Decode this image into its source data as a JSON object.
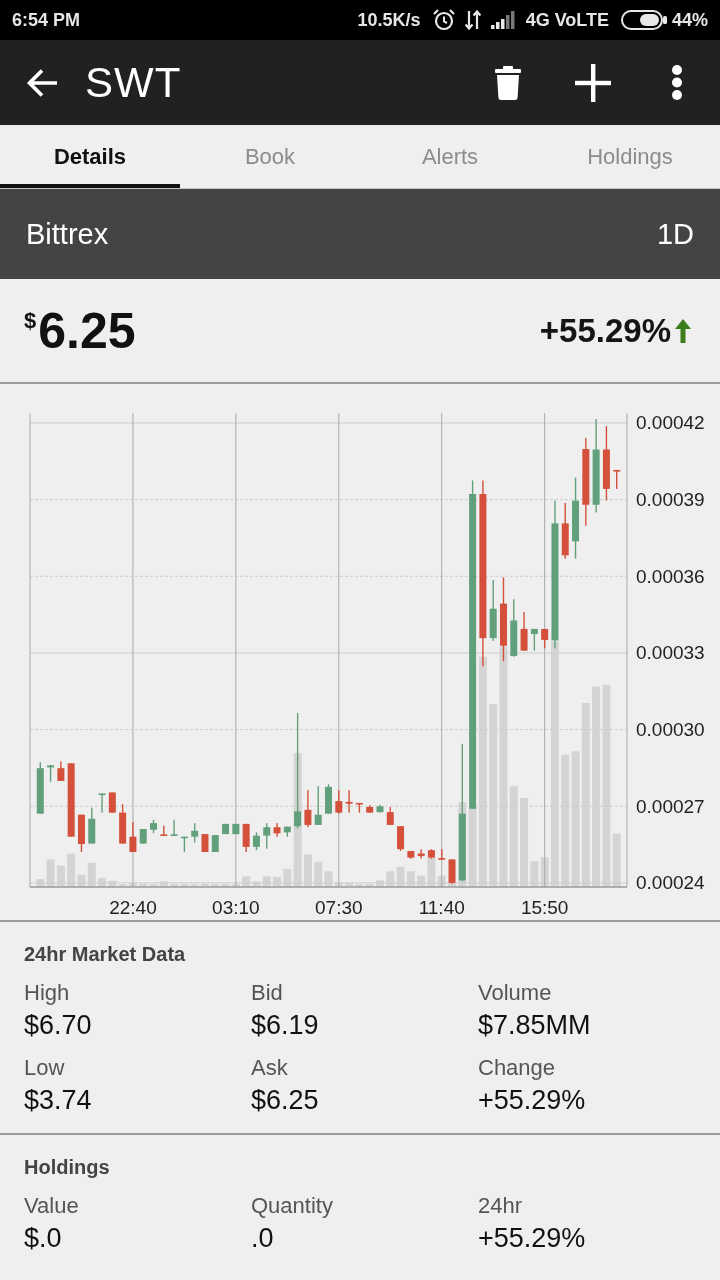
{
  "status_bar": {
    "time": "6:54 PM",
    "network_speed": "10.5K/s",
    "network": "4G VoLTE",
    "battery": "44%"
  },
  "app_bar": {
    "title": "SWT"
  },
  "tabs": [
    {
      "label": "Details",
      "selected": true
    },
    {
      "label": "Book",
      "selected": false
    },
    {
      "label": "Alerts",
      "selected": false
    },
    {
      "label": "Holdings",
      "selected": false
    }
  ],
  "exchange_bar": {
    "exchange": "Bittrex",
    "timeframe": "1D"
  },
  "price": {
    "currency": "$",
    "amount": "6.25",
    "change": "+55.29%",
    "rising": true
  },
  "chart": {
    "chart_data": {
      "type": "candlestick",
      "grid": true,
      "categories": [
        null,
        null,
        null,
        null,
        null,
        null,
        null,
        null,
        null,
        "22:40",
        null,
        null,
        null,
        null,
        null,
        null,
        null,
        null,
        null,
        "03:10",
        null,
        null,
        null,
        null,
        null,
        null,
        null,
        null,
        null,
        "07:30",
        null,
        null,
        null,
        null,
        null,
        null,
        null,
        null,
        null,
        "11:40",
        null,
        null,
        null,
        null,
        null,
        null,
        null,
        null,
        null,
        "15:50",
        null,
        null,
        null,
        null,
        null,
        null,
        null
      ],
      "ohlc": [
        [
          0.0002671,
          0.0002872,
          0.0002671,
          0.0002849
        ],
        [
          0.0002852,
          0.0002862,
          0.0002796,
          0.000286
        ],
        [
          0.0002849,
          0.0002875,
          0.0002799,
          0.0002799
        ],
        [
          0.0002868,
          0.0002868,
          0.0002581,
          0.0002581
        ],
        [
          0.0002667,
          0.0002667,
          0.0002521,
          0.0002552
        ],
        [
          0.0002554,
          0.0002694,
          0.0002554,
          0.0002651
        ],
        [
          0.0002745,
          0.000275,
          0.0002675,
          0.000275
        ],
        [
          0.0002754,
          0.0002754,
          0.0002675,
          0.0002675
        ],
        [
          0.0002675,
          0.0002708,
          0.0002554,
          0.0002554
        ],
        [
          0.0002581,
          0.0002638,
          0.0002521,
          0.0002521
        ],
        [
          0.0002554,
          0.0002611,
          0.0002554,
          0.0002611
        ],
        [
          0.0002608,
          0.0002647,
          0.0002595,
          0.0002634
        ],
        [
          0.000259,
          0.0002624,
          0.0002585,
          0.0002585
        ],
        [
          0.0002585,
          0.0002647,
          0.0002585,
          0.000259
        ],
        [
          0.0002575,
          0.0002581,
          0.0002521,
          0.0002581
        ],
        [
          0.0002581,
          0.0002634,
          0.0002558,
          0.0002604
        ],
        [
          0.0002591,
          0.0002591,
          0.0002521,
          0.0002521
        ],
        [
          0.0002521,
          0.0002587,
          0.0002521,
          0.0002587
        ],
        [
          0.0002591,
          0.0002631,
          0.0002591,
          0.0002631
        ],
        [
          0.0002591,
          0.0002631,
          0.0002591,
          0.0002631
        ],
        [
          0.0002631,
          0.0002631,
          0.0002521,
          0.0002541
        ],
        [
          0.0002541,
          0.0002598,
          0.0002528,
          0.0002585
        ],
        [
          0.0002585,
          0.0002634,
          0.0002534,
          0.0002618
        ],
        [
          0.0002618,
          0.0002634,
          0.0002581,
          0.0002594
        ],
        [
          0.0002598,
          0.000262,
          0.0002581,
          0.000262
        ],
        [
          0.0002622,
          0.0003065,
          0.0002614,
          0.000268
        ],
        [
          0.0002686,
          0.0002763,
          0.0002618,
          0.0002627
        ],
        [
          0.0002627,
          0.0002779,
          0.0002627,
          0.0002667
        ],
        [
          0.0002671,
          0.0002786,
          0.0002671,
          0.0002776
        ],
        [
          0.000272,
          0.0002763,
          0.0002671,
          0.0002675
        ],
        [
          0.0002717,
          0.0002763,
          0.0002675,
          0.000271
        ],
        [
          0.0002713,
          0.0002713,
          0.0002675,
          0.0002708
        ],
        [
          0.0002697,
          0.0002704,
          0.0002675,
          0.0002675
        ],
        [
          0.0002677,
          0.0002706,
          0.0002675,
          0.00027
        ],
        [
          0.0002677,
          0.0002697,
          0.0002627,
          0.0002627
        ],
        [
          0.0002622,
          0.0002622,
          0.0002525,
          0.0002532
        ],
        [
          0.0002525,
          0.0002525,
          0.0002495,
          0.0002499
        ],
        [
          0.0002515,
          0.0002532,
          0.0002495,
          0.0002505
        ],
        [
          0.0002528,
          0.0002532,
          0.0002495,
          0.0002499
        ],
        [
          0.0002497,
          0.0002532,
          0.0002492,
          0.0002492
        ],
        [
          0.0002492,
          0.0002492,
          0.0002397,
          0.00024
        ],
        [
          0.000241,
          0.0002944,
          0.0002406,
          0.0002671
        ],
        [
          0.000269,
          0.0003975,
          0.000269,
          0.0003922
        ],
        [
          0.0003922,
          0.0003975,
          0.0003248,
          0.0003358
        ],
        [
          0.0003358,
          0.0003585,
          0.0003347,
          0.0003473
        ],
        [
          0.0003493,
          0.0003596,
          0.0003268,
          0.0003328
        ],
        [
          0.0003288,
          0.000351,
          0.0003285,
          0.0003427
        ],
        [
          0.0003394,
          0.000346,
          0.0003309,
          0.0003309
        ],
        [
          0.0003374,
          0.0003394,
          0.0003309,
          0.0003394
        ],
        [
          0.0003394,
          0.0003394,
          0.0003318,
          0.0003351
        ],
        [
          0.0003349,
          0.0003896,
          0.0003318,
          0.0003807
        ],
        [
          0.0003807,
          0.0003887,
          0.0003669,
          0.0003682
        ],
        [
          0.0003737,
          0.0003986,
          0.0003669,
          0.0003896
        ],
        [
          0.0004098,
          0.0004141,
          0.0003798,
          0.000388
        ],
        [
          0.000388,
          0.0004215,
          0.000385,
          0.0004096
        ],
        [
          0.0004096,
          0.0004188,
          0.0003897,
          0.0003942
        ],
        [
          0.0004016,
          0.0004016,
          0.0003942,
          0.000401
        ]
      ],
      "ylim": [
        0.0002384,
        0.0004239
      ],
      "yticks": [
        {
          "value": 0.00042,
          "label": "0.00042"
        },
        {
          "value": 0.00039,
          "label": "0.00039"
        },
        {
          "value": 0.00036,
          "label": "0.00036"
        },
        {
          "value": 0.00033,
          "label": "0.00033"
        },
        {
          "value": 0.0003,
          "label": "0.00030"
        },
        {
          "value": 0.00027,
          "label": "0.00027"
        },
        {
          "value": 0.00024,
          "label": "0.00024"
        }
      ]
    }
  },
  "market_data": {
    "title": "24hr Market Data",
    "items": [
      {
        "label": "High",
        "value": "$6.70"
      },
      {
        "label": "Bid",
        "value": "$6.19"
      },
      {
        "label": "Volume",
        "value": "$7.85MM"
      },
      {
        "label": "Low",
        "value": "$3.74"
      },
      {
        "label": "Ask",
        "value": "$6.25"
      },
      {
        "label": "Change",
        "value": "+55.29%"
      }
    ]
  },
  "holdings": {
    "title": "Holdings",
    "items": [
      {
        "label": "Value",
        "value": "$.0"
      },
      {
        "label": "Quantity",
        "value": ".0"
      },
      {
        "label": "24hr",
        "value": "+55.29%"
      }
    ]
  }
}
